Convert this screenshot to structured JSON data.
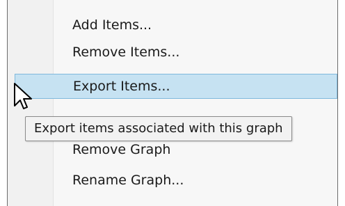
{
  "context_menu": {
    "items": [
      {
        "label": "Add Items..."
      },
      {
        "label": "Remove Items..."
      },
      {
        "label": "Export Items...",
        "highlighted": true
      },
      {
        "label": "Remove Graph"
      },
      {
        "label": "Rename Graph..."
      }
    ],
    "tooltip": "Export items associated with this graph"
  },
  "colors": {
    "highlight_fill": "#c6e2f2",
    "highlight_border": "#7fb8dc",
    "menu_background": "#f7f7f7",
    "tooltip_background": "#f2f2f2"
  },
  "icons": {
    "cursor": "arrow-cursor-icon"
  }
}
